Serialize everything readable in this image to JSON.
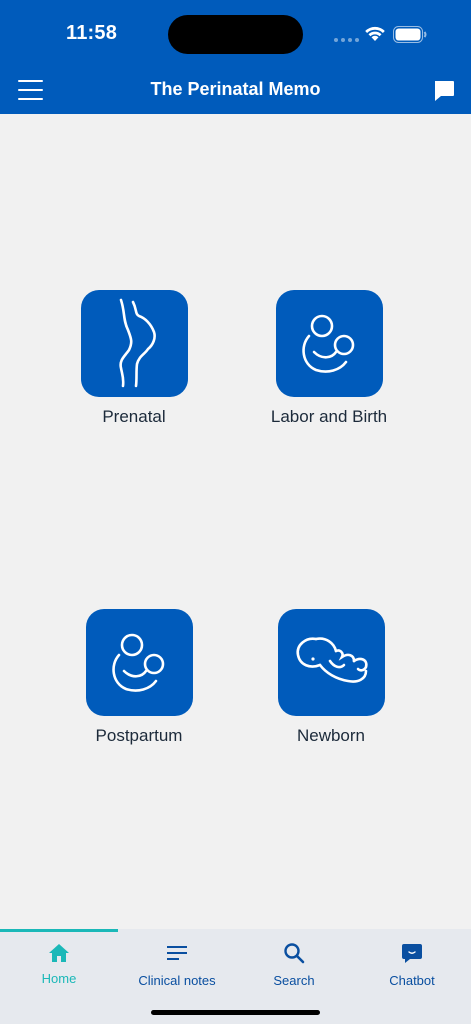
{
  "status_bar": {
    "time": "11:58"
  },
  "header": {
    "title": "The Perinatal Memo"
  },
  "colors": {
    "brand": "#005bbb",
    "accent": "#1bb8b8",
    "background": "#f1f1f1"
  },
  "categories": [
    {
      "label": "Prenatal",
      "icon": "pregnant-silhouette-icon"
    },
    {
      "label": "Labor and Birth",
      "icon": "mother-baby-icon"
    },
    {
      "label": "Postpartum",
      "icon": "mother-baby-icon"
    },
    {
      "label": "Newborn",
      "icon": "newborn-icon"
    }
  ],
  "nav": {
    "items": [
      {
        "label": "Home",
        "icon": "home-icon",
        "active": true
      },
      {
        "label": "Clinical notes",
        "icon": "notes-icon",
        "active": false
      },
      {
        "label": "Search",
        "icon": "search-icon",
        "active": false
      },
      {
        "label": "Chatbot",
        "icon": "chat-icon",
        "active": false
      }
    ]
  }
}
